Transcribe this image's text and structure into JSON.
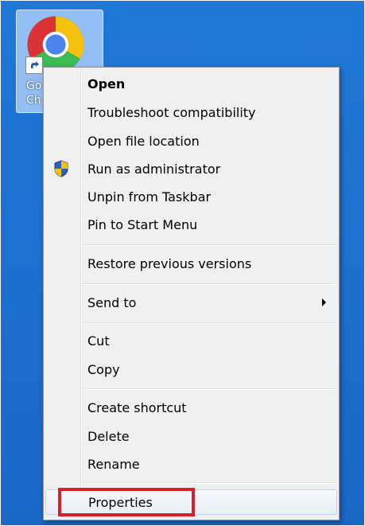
{
  "desktop": {
    "icon_caption_line1": "Go",
    "icon_caption_line2": "Ch",
    "icon": "chrome-icon"
  },
  "menu": {
    "items": [
      {
        "label": "Open",
        "bold": true
      },
      {
        "label": "Troubleshoot compatibility"
      },
      {
        "label": "Open file location"
      },
      {
        "label": "Run as administrator",
        "icon": "uac-shield-icon"
      },
      {
        "label": "Unpin from Taskbar"
      },
      {
        "label": "Pin to Start Menu"
      },
      {
        "label": "Restore previous versions"
      },
      {
        "label": "Send to",
        "submenu": true
      },
      {
        "label": "Cut"
      },
      {
        "label": "Copy"
      },
      {
        "label": "Create shortcut"
      },
      {
        "label": "Delete"
      },
      {
        "label": "Rename"
      },
      {
        "label": "Properties",
        "highlighted": true
      }
    ]
  },
  "colors": {
    "desktop_blue": "#1d6fd0",
    "menu_bg": "#f0f0f0",
    "highlight_box": "#d8202a"
  }
}
